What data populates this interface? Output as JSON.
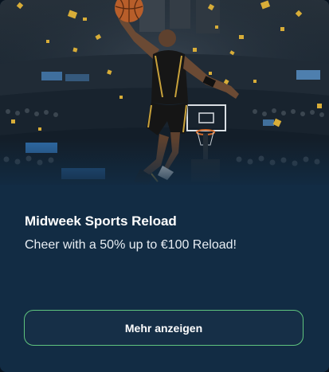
{
  "promo": {
    "title": "Midweek Sports Reload",
    "description": "Cheer with a 50% up to €100 Reload!",
    "button_label": "Mehr anzeigen"
  },
  "colors": {
    "card_background": "#122c44",
    "button_border": "#5fc47e",
    "title_text": "#ffffff",
    "confetti": "#d8ad38"
  },
  "hero_image": {
    "icon": "basketball-player-dunk-image"
  }
}
